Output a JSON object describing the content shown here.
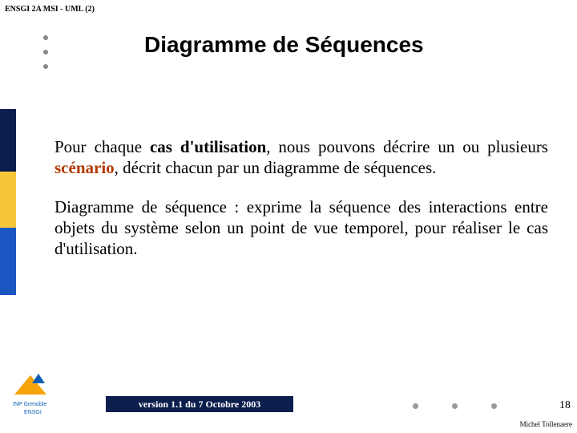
{
  "header": "ENSGI 2A MSI - UML (2)",
  "title": "Diagramme de Séquences",
  "para1": {
    "t1": "Pour chaque ",
    "bold1": "cas d'utilisation",
    "t2": ", nous pouvons décrire un ou plusieurs ",
    "scenario": "scénario",
    "t3": ", décrit chacun par un diagramme de séquences."
  },
  "para2": "Diagramme de séquence : exprime la séquence des interactions entre objets du système selon un point de vue temporel, pour réaliser le cas d'utilisation.",
  "footer": {
    "version": "version 1.1 du 7 Octobre 2003",
    "page": "18",
    "author": "Michel Tollenaere",
    "logo_lines": {
      "l1": "INP Grenoble",
      "l2": "ENSGI"
    }
  }
}
